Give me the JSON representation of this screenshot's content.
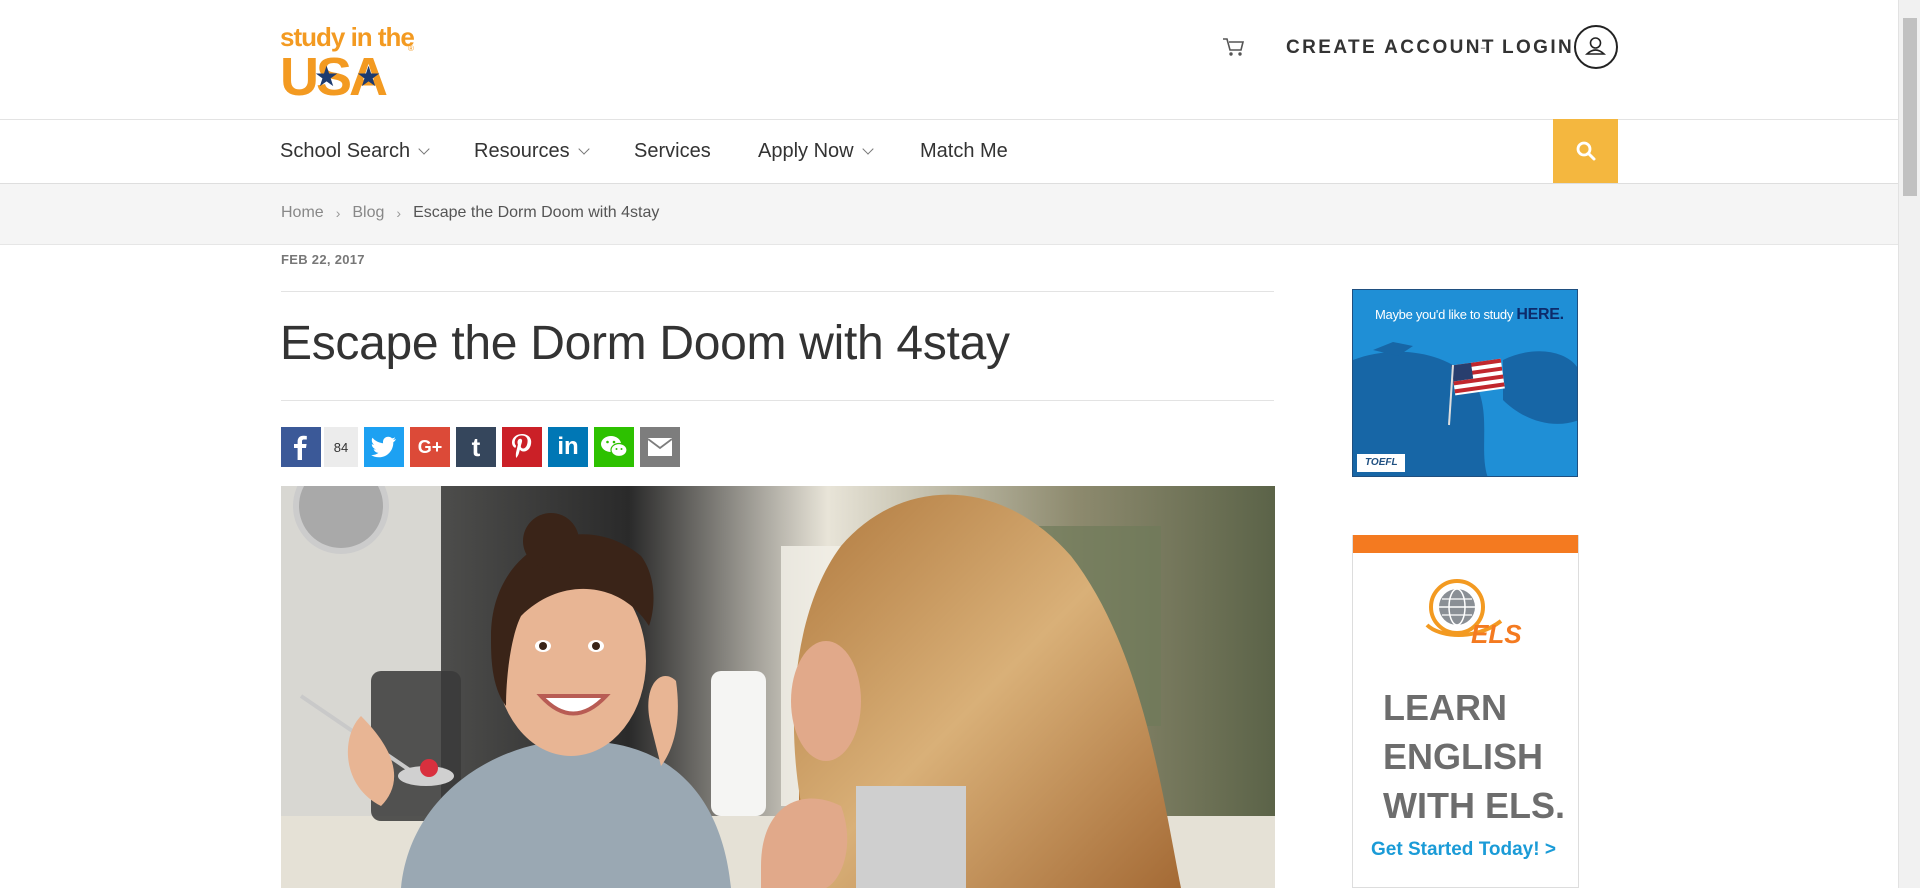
{
  "logo": {
    "line1": "study in the",
    "line2": "USA",
    "reg": "®"
  },
  "header": {
    "create_account": "CREATE ACCOUNT",
    "separator": "-",
    "login": "LOGIN",
    "icons": [
      "cart-icon",
      "user-icon"
    ]
  },
  "nav": {
    "items": [
      {
        "label": "School Search",
        "has_dropdown": true
      },
      {
        "label": "Resources",
        "has_dropdown": true
      },
      {
        "label": "Services",
        "has_dropdown": false
      },
      {
        "label": "Apply Now",
        "has_dropdown": true
      },
      {
        "label": "Match Me",
        "has_dropdown": false
      }
    ],
    "search_icon": "search-icon"
  },
  "breadcrumb": {
    "items": [
      "Home",
      "Blog",
      "Escape the Dorm Doom with 4stay"
    ],
    "separator": "›"
  },
  "article": {
    "date": "FEB 22, 2017",
    "title": "Escape the Dorm Doom with 4stay",
    "share": {
      "facebook_count": "84",
      "buttons": [
        "facebook",
        "twitter",
        "google-plus",
        "tumblr",
        "pinterest",
        "linkedin",
        "wechat",
        "email"
      ]
    }
  },
  "ads": {
    "toefl": {
      "tagline": "Maybe you'd like to study",
      "emphasis": "HERE.",
      "brand": "TOEFL"
    },
    "els": {
      "brand": "ELS",
      "line1": "LEARN",
      "line2": "ENGLISH",
      "line3": "WITH ELS.",
      "cta": "Get Started Today! >"
    }
  },
  "colors": {
    "brand_orange": "#f39a21",
    "search_yellow": "#f4b73f",
    "facebook": "#3b5998",
    "twitter": "#1da1f2",
    "google_plus": "#dc4a38",
    "tumblr": "#35465c",
    "pinterest": "#cb2027",
    "linkedin": "#0077b5",
    "wechat": "#2dc100",
    "email": "#7d7d7d"
  }
}
